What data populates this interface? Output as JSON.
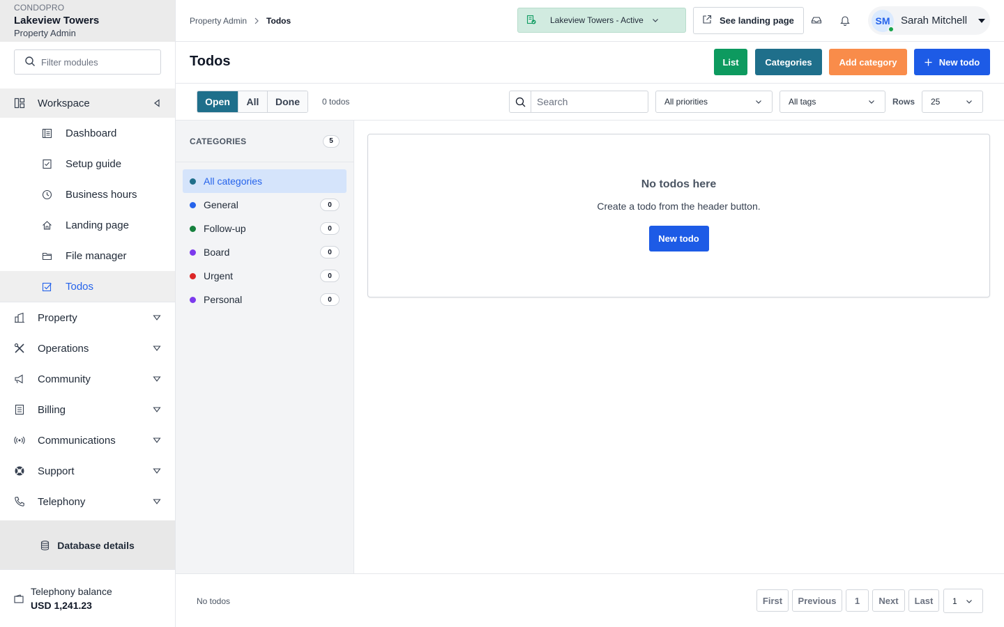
{
  "brand": {
    "sup": "CONDOPRO",
    "name": "Lakeview Towers",
    "role": "Property Admin"
  },
  "sidebar": {
    "filter_placeholder": "Filter modules",
    "workspace_label": "Workspace",
    "workspace_items": [
      {
        "label": "Dashboard",
        "icon": "dashboard-icon"
      },
      {
        "label": "Setup guide",
        "icon": "checklist-icon"
      },
      {
        "label": "Business hours",
        "icon": "clock-icon"
      },
      {
        "label": "Landing page",
        "icon": "home-icon"
      },
      {
        "label": "File manager",
        "icon": "folder-icon"
      },
      {
        "label": "Todos",
        "icon": "todo-icon"
      }
    ],
    "groups": [
      {
        "label": "Property",
        "icon": "building-icon"
      },
      {
        "label": "Operations",
        "icon": "tools-icon"
      },
      {
        "label": "Community",
        "icon": "megaphone-icon"
      },
      {
        "label": "Billing",
        "icon": "billing-icon"
      },
      {
        "label": "Communications",
        "icon": "broadcast-icon"
      },
      {
        "label": "Support",
        "icon": "lifebuoy-icon"
      },
      {
        "label": "Telephony",
        "icon": "phone-icon"
      }
    ],
    "db_details": "Database details",
    "balance_label": "Telephony balance",
    "balance_value": "USD 1,241.23"
  },
  "topbar": {
    "crumb_root": "Property Admin",
    "crumb_current": "Todos",
    "property_select": "Lakeview Towers - Active",
    "landing_button": "See landing page",
    "user_initials": "SM",
    "user_name": "Sarah Mitchell"
  },
  "page": {
    "title": "Todos",
    "btn_list": "List",
    "btn_categories": "Categories",
    "btn_add_category": "Add category",
    "btn_new_todo": "New todo"
  },
  "toolbar": {
    "tabs": [
      "Open",
      "All",
      "Done"
    ],
    "count": "0 todos",
    "search_placeholder": "Search",
    "priority": "All priorities",
    "tags": "All tags",
    "rows_label": "Rows",
    "rows_value": "25"
  },
  "categories": {
    "title": "CATEGORIES",
    "total": "5",
    "items": [
      {
        "name": "All categories",
        "color": "#1f6f8b",
        "count": ""
      },
      {
        "name": "General",
        "color": "#2563eb",
        "count": "0"
      },
      {
        "name": "Follow-up",
        "color": "#15803d",
        "count": "0"
      },
      {
        "name": "Board",
        "color": "#7c3aed",
        "count": "0"
      },
      {
        "name": "Urgent",
        "color": "#dc2626",
        "count": "0"
      },
      {
        "name": "Personal",
        "color": "#7c3aed",
        "count": "0"
      }
    ]
  },
  "empty": {
    "heading": "No todos here",
    "text": "Create a todo from the header button.",
    "button": "New todo"
  },
  "footer": {
    "status": "No todos",
    "first": "First",
    "previous": "Previous",
    "page": "1",
    "next": "Next",
    "last": "Last",
    "page_select": "1"
  }
}
